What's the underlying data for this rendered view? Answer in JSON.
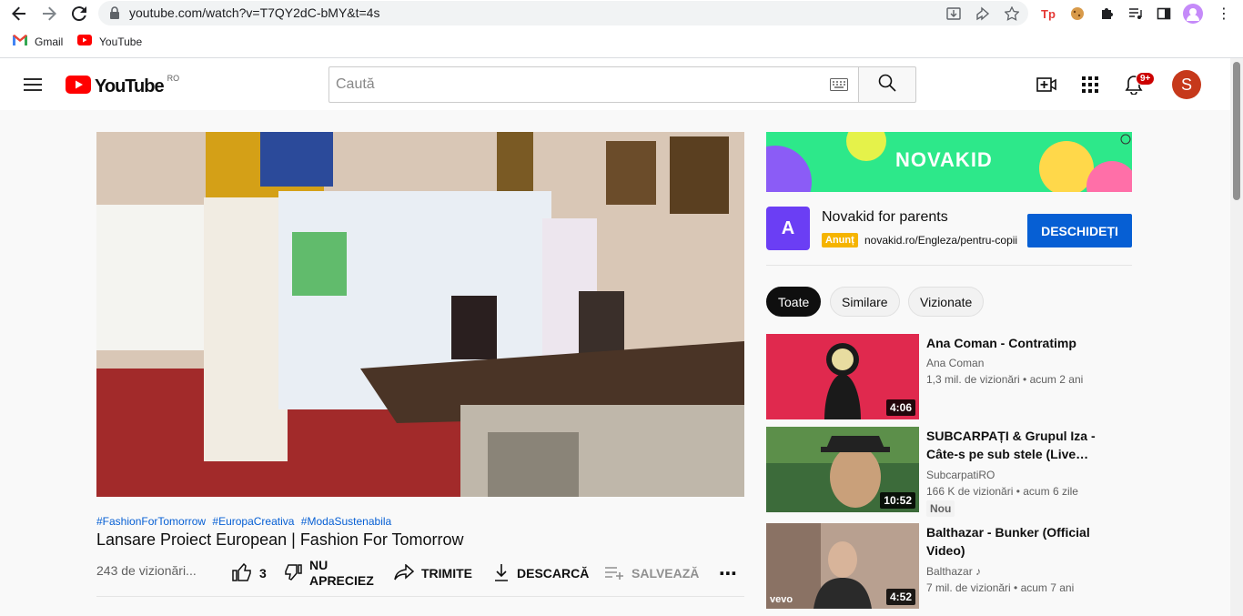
{
  "browser": {
    "url": "youtube.com/watch?v=T7QY2dC-bMY&t=4s",
    "bookmarks": [
      {
        "label": "Gmail",
        "icon": "gmail-icon"
      },
      {
        "label": "YouTube",
        "icon": "youtube-icon"
      }
    ],
    "extensions": [
      "tp-extension-icon",
      "cookie-extension-icon",
      "puzzle-icon",
      "media-control-icon",
      "side-panel-icon",
      "profile-icon",
      "menu-kebab-icon"
    ]
  },
  "header": {
    "logo_text": "YouTube",
    "region": "RO",
    "search_placeholder": "Caută",
    "notifications_badge": "9+",
    "avatar_letter": "S"
  },
  "video": {
    "hashtags": [
      "#FashionForTomorrow",
      "#EuropaCreativa",
      "#ModaSustenabila"
    ],
    "title": "Lansare Proiect European | Fashion For Tomorrow",
    "views": "243 de vizionări...",
    "actions": {
      "likes": "3",
      "dislike_line1": "NU",
      "dislike_line2": "APRECIEZ",
      "share": "TRIMITE",
      "download": "DESCARCĂ",
      "save": "SALVEAZĂ"
    }
  },
  "ad": {
    "banner_text": "NOVAKID",
    "title": "Novakid for parents",
    "tag": "Anunț",
    "url": "novakid.ro/Engleza/pentru-copii",
    "cta": "DESCHIDEȚI",
    "logo_letter": "A"
  },
  "chips": [
    {
      "label": "Toate",
      "active": true
    },
    {
      "label": "Similare",
      "active": false
    },
    {
      "label": "Vizionate",
      "active": false
    }
  ],
  "recommendations": [
    {
      "title": "Ana Coman - Contratimp",
      "channel": "Ana Coman",
      "meta": "1,3 mil. de vizionări • acum 2 ani",
      "duration": "4:06",
      "badge": ""
    },
    {
      "title": "SUBCARPAȚI & Grupul Iza - Câte-s pe sub stele (Live…",
      "channel": "SubcarpatiRO",
      "meta": "166 K de vizionări • acum 6 zile",
      "duration": "10:52",
      "badge": "Nou"
    },
    {
      "title": "Balthazar - Bunker (Official Video)",
      "channel": "Balthazar ♪",
      "meta": "7 mil. de vizionări • acum 7 ani",
      "duration": "4:52",
      "badge": "",
      "thumb_label": "vevo"
    }
  ],
  "colors": {
    "brand_red": "#ff0000",
    "link_blue": "#065fd4",
    "ad_green": "#2de88a",
    "ad_purple": "#6b3ef4",
    "avatar": "#c6391b"
  }
}
